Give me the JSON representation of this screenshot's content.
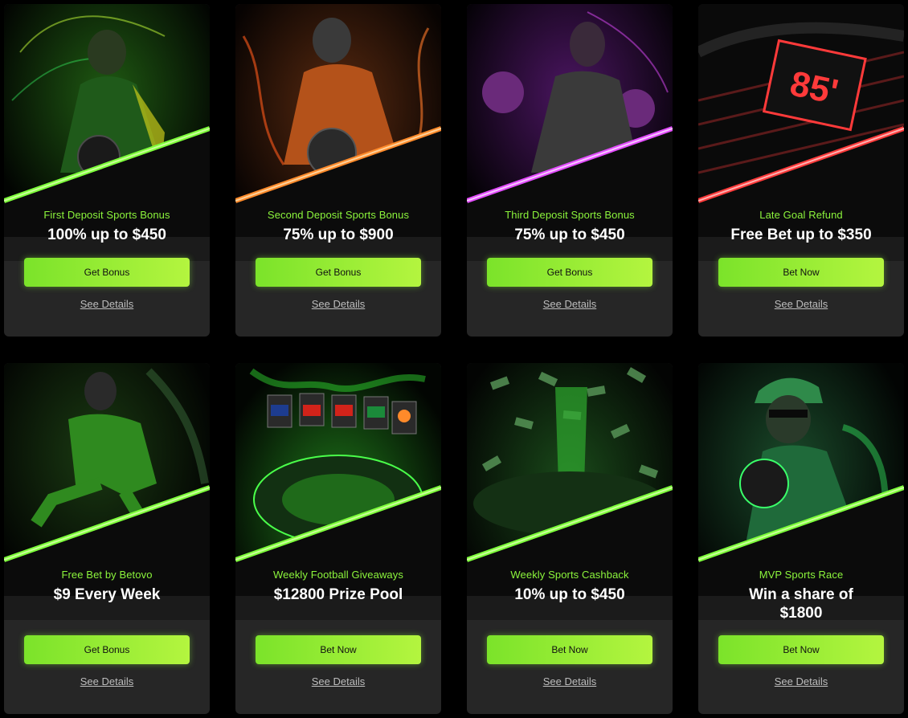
{
  "colors": {
    "background": "#000000",
    "card": "#262626",
    "accent_green": "#8cf53c",
    "button_gradient_start": "#7be32a",
    "button_gradient_end": "#b4f53f",
    "details_text": "#bdbdbd"
  },
  "promotions": [
    {
      "subtitle": "First Deposit Sports Bonus",
      "headline": "100% up to $450",
      "button": "Get Bonus",
      "details": "See Details",
      "art": "soccer-player-neon-green",
      "stripe_color": "#7dff3a"
    },
    {
      "subtitle": "Second Deposit Sports Bonus",
      "headline": "75% up to $900",
      "button": "Get Bonus",
      "details": "See Details",
      "art": "basketball-player-fire-orange",
      "stripe_color": "#ff8a2a"
    },
    {
      "subtitle": "Third Deposit Sports Bonus",
      "headline": "75% up to $450",
      "button": "Get Bonus",
      "details": "See Details",
      "art": "female-boxer-purple",
      "stripe_color": "#e34cff"
    },
    {
      "subtitle": "Late Goal Refund",
      "headline": "Free Bet up to $350",
      "button": "Bet Now",
      "details": "See Details",
      "art": "stadium-scoreboard-red",
      "stripe_color": "#ff3a3a",
      "scoreboard_text": "85'"
    },
    {
      "subtitle": "Free Bet by Betovo",
      "headline": "$9 Every Week",
      "button": "Get Bonus",
      "details": "See Details",
      "art": "soccer-player-kick-green",
      "stripe_color": "#7dff3a"
    },
    {
      "subtitle": "Weekly Football Giveaways",
      "headline": "$12800 Prize Pool",
      "button": "Bet Now",
      "details": "See Details",
      "art": "stadium-flags-green",
      "stripe_color": "#7dff3a"
    },
    {
      "subtitle": "Weekly Sports Cashback",
      "headline": "10% up to $450",
      "button": "Bet Now",
      "details": "See Details",
      "art": "stadium-money-rain",
      "stripe_color": "#7dff3a"
    },
    {
      "subtitle": "MVP Sports Race",
      "headline": "Win a share of $1800",
      "button": "Bet Now",
      "details": "See Details",
      "art": "man-with-ball-green",
      "stripe_color": "#7dff3a"
    }
  ]
}
